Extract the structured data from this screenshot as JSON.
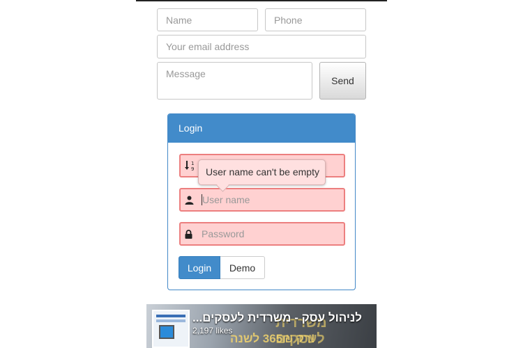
{
  "contact_form": {
    "name_placeholder": "Name",
    "phone_placeholder": "Phone",
    "email_placeholder": "Your email address",
    "message_placeholder": "Message",
    "send_label": "Send"
  },
  "login_panel": {
    "heading": "Login",
    "sort_field_glyph_top": "1",
    "sort_field_glyph_bottom": "9",
    "tooltip": "User name can't be empty",
    "username_placeholder": "User name",
    "password_placeholder": "Password",
    "login_button": "Login",
    "demo_button": "Demo"
  },
  "facebook_widget": {
    "page_title": "לניהול עסק - משרדית לעסקים...",
    "likes": "2,197 likes",
    "cover_text_1": "משרדית לעסקים",
    "cover_text_2": "רק 365₪ לשנה!"
  },
  "colors": {
    "primary": "#428bca",
    "error_bg": "#ffd1d1",
    "error_border": "#ec7f7f"
  }
}
